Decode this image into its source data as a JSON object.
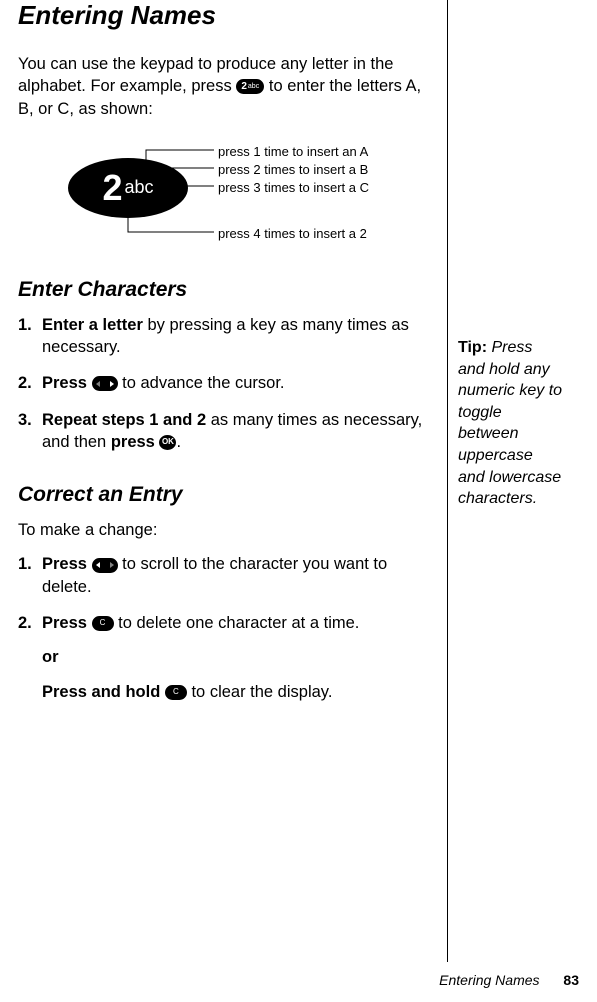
{
  "title": "Entering Names",
  "intro": {
    "part1": "You can use the keypad to produce any letter in the alphabet. For example, press ",
    "part2": " to enter the letters A, B, or C, as shown:"
  },
  "diagram": {
    "key_number": "2",
    "key_letters": "abc",
    "callouts": [
      "press 1 time to insert an A",
      "press 2 times to insert a B",
      "press 3 times to insert a C",
      "press 4 times to insert a 2"
    ]
  },
  "section_enter_characters": {
    "heading": "Enter Characters",
    "steps": [
      {
        "num": "1.",
        "bold": "Enter a letter",
        "rest": " by pressing a key as many times as necessary."
      },
      {
        "num": "2.",
        "bold": "Press ",
        "rest": " to advance the cursor."
      },
      {
        "num": "3.",
        "bold_a": "Repeat steps 1 and 2",
        "mid": " as many times as necessary, and then ",
        "bold_b": "press ",
        "tail": "."
      }
    ]
  },
  "section_correct_entry": {
    "heading": "Correct an Entry",
    "intro": "To make a change:",
    "steps": [
      {
        "num": "1.",
        "bold": "Press ",
        "rest": " to scroll to the character you want to delete."
      },
      {
        "num": "2.",
        "bold": "Press ",
        "rest": " to delete one character at a time."
      }
    ],
    "or": "or",
    "hold": {
      "bold": "Press and hold ",
      "rest": " to clear the display."
    }
  },
  "tip": {
    "label": "Tip:",
    "text": " Press and hold any numeric key to toggle between uppercase and lowercase characters."
  },
  "icons": {
    "key2_num": "2",
    "key2_abc": "abc",
    "ok": "OK",
    "c": "C"
  },
  "footer": {
    "section": "Entering Names",
    "page": "83"
  }
}
